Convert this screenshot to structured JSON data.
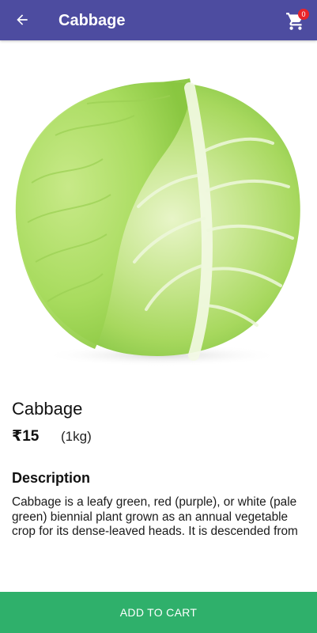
{
  "appbar": {
    "title": "Cabbage",
    "back_icon": "arrow-left-icon",
    "cart_icon": "cart-icon",
    "cart_count": "0",
    "color": "#4d4ca0"
  },
  "product": {
    "image": "cabbage-photo",
    "name": "Cabbage",
    "price": "₹15",
    "unit": "(1kg)"
  },
  "description": {
    "heading": "Description",
    "text": "Cabbage is a leafy green, red (purple), or white (pale green) biennial plant grown as an annual vegetable crop for its dense-leaved heads. It is descended from"
  },
  "actions": {
    "add_to_cart": "ADD TO CART",
    "color": "#2fb06b"
  }
}
